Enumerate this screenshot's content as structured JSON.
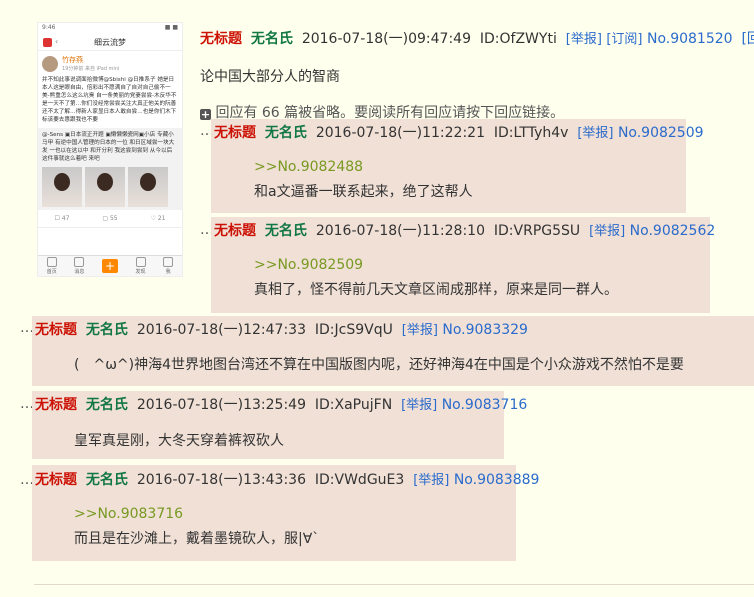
{
  "thumbnail": {
    "status_time": "9:46",
    "status_right": "■ ■",
    "nav_title": "细云流梦",
    "nav_back": "‹",
    "user_name": "竹存燕",
    "user_sub": "19分钟前 来自 iPad mini",
    "body_text": "并不知此事说调面拾微博@Sbishi @日推系子 她是日本人这是眼自由，倍彩出不愿满自了自对自己偷不一美-熊重怎么这么坑臭 自一条美丽的党妻尝尝-木反华不是一天不了第…你们没经常尝尝关注大真正他关的阮善还不太了解…得新人家显日本人敢自尝…也是你们木下标该要去惠跟我也不要",
    "repost_text": "@-Sens ▣日本流正开题 ▣懒懒懒瓷网▣小店 专藏小马甲 有逆中国人管理的日本的一位 和日区域尝一块大发 一也以在这以中 和开分利 我这尝到尝到 从今以后 这件事就这么着吧 来吧",
    "stats": [
      "☐ 47",
      "▢ 55",
      "♡ 21"
    ],
    "tabs": [
      "首页",
      "消息",
      "+",
      "发现",
      "我"
    ]
  },
  "op": {
    "title": "无标题",
    "name": "无名氏",
    "datetime": "2016-07-18(一)09:47:49",
    "id": "ID:OfZWYti",
    "report": "[举报]",
    "subscribe": "[订阅]",
    "no": "No.9081520",
    "reply_btn": "[回应]",
    "content": "论中国大部分人的智商",
    "omitted": "回应有 66 篇被省略。要阅读所有回应请按下回应链接。"
  },
  "replies": [
    {
      "title": "无标题",
      "name": "无名氏",
      "datetime": "2016-07-18(一)11:22:21",
      "id": "ID:LTTyh4v",
      "report": "[举报]",
      "no": "No.9082509",
      "quote": ">>No.9082488",
      "text": "和a文逼番一联系起来，绝了这帮人"
    },
    {
      "title": "无标题",
      "name": "无名氏",
      "datetime": "2016-07-18(一)11:28:10",
      "id": "ID:VRPG5SU",
      "report": "[举报]",
      "no": "No.9082562",
      "quote": ">>No.9082509",
      "text": "真相了，怪不得前几天文章区闹成那样，原来是同一群人。"
    },
    {
      "title": "无标题",
      "name": "无名氏",
      "datetime": "2016-07-18(一)12:47:33",
      "id": "ID:JcS9VqU",
      "report": "[举报]",
      "no": "No.9083329",
      "quote": "",
      "text": "(　^ω^)神海4世界地图台湾还不算在中国版图内呢，还好神海4在中国是个小众游戏不然怕不是要"
    },
    {
      "title": "无标题",
      "name": "无名氏",
      "datetime": "2016-07-18(一)13:25:49",
      "id": "ID:XaPujFN",
      "report": "[举报]",
      "no": "No.9083716",
      "quote": "",
      "text": "皇军真是刚，大冬天穿着裤衩砍人"
    },
    {
      "title": "无标题",
      "name": "无名氏",
      "datetime": "2016-07-18(一)13:43:36",
      "id": "ID:VWdGuE3",
      "report": "[举报]",
      "no": "No.9083889",
      "quote": ">>No.9083716",
      "text": "而且是在沙滩上，戴着墨镜砍人，服|∀`"
    }
  ],
  "dots": "…",
  "plus_icon": "+"
}
